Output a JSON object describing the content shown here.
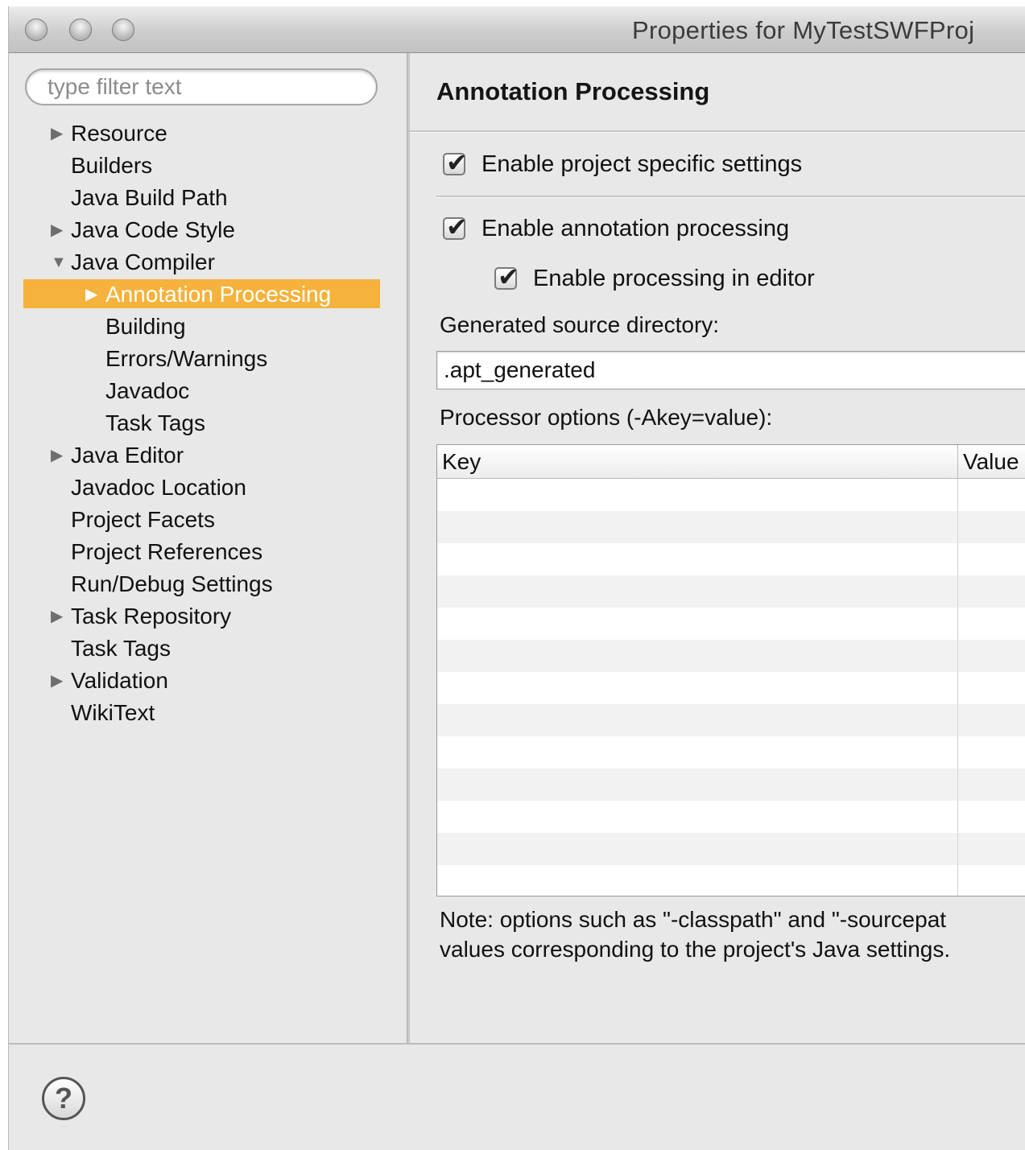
{
  "window": {
    "title": "Properties for MyTestSWFProj"
  },
  "filter": {
    "placeholder": "type filter text"
  },
  "tree": {
    "items": [
      {
        "label": "Resource",
        "expander": "collapsed"
      },
      {
        "label": "Builders",
        "expander": "none"
      },
      {
        "label": "Java Build Path",
        "expander": "none"
      },
      {
        "label": "Java Code Style",
        "expander": "collapsed"
      },
      {
        "label": "Java Compiler",
        "expander": "expanded"
      },
      {
        "label": "Annotation Processing",
        "expander": "collapsed",
        "selected": true
      },
      {
        "label": "Building",
        "expander": "none"
      },
      {
        "label": "Errors/Warnings",
        "expander": "none"
      },
      {
        "label": "Javadoc",
        "expander": "none"
      },
      {
        "label": "Task Tags",
        "expander": "none"
      },
      {
        "label": "Java Editor",
        "expander": "collapsed"
      },
      {
        "label": "Javadoc Location",
        "expander": "none"
      },
      {
        "label": "Project Facets",
        "expander": "none"
      },
      {
        "label": "Project References",
        "expander": "none"
      },
      {
        "label": "Run/Debug Settings",
        "expander": "none"
      },
      {
        "label": "Task Repository",
        "expander": "collapsed"
      },
      {
        "label": "Task Tags",
        "expander": "none"
      },
      {
        "label": "Validation",
        "expander": "collapsed"
      },
      {
        "label": "WikiText",
        "expander": "none"
      }
    ],
    "selected_color": "#f5b23c"
  },
  "page": {
    "title": "Annotation Processing",
    "enable_project_specific": {
      "label": "Enable project specific settings",
      "checked": true
    },
    "enable_annotation_processing": {
      "label": "Enable annotation processing",
      "checked": true
    },
    "enable_processing_in_editor": {
      "label": "Enable processing in editor",
      "checked": true
    },
    "generated_source_label": "Generated source directory:",
    "generated_source_value": ".apt_generated",
    "processor_options_label": "Processor options (-Akey=value):",
    "table": {
      "columns": [
        "Key",
        "Value"
      ],
      "rows": []
    },
    "note_line1": "Note: options such as \"-classpath\" and \"-sourcepat",
    "note_line2": "values corresponding to the project's Java settings."
  },
  "icons": {
    "help": "help-icon",
    "checkmark": "checkmark-icon",
    "expand": "triangle-right-icon",
    "collapse": "triangle-down-icon"
  },
  "help_glyph": "?",
  "glyphs": {
    "collapsed": "▶",
    "expanded": "▼",
    "check": "✔"
  }
}
